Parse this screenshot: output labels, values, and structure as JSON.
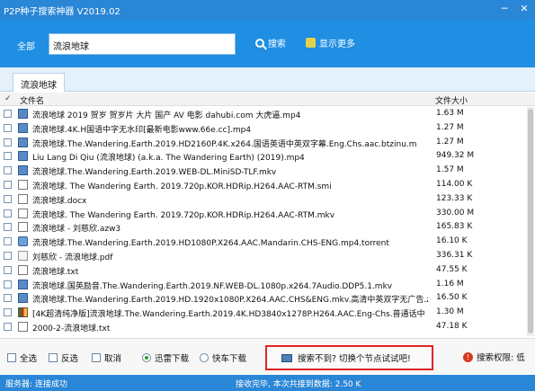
{
  "window": {
    "title": "P2P种子搜索神器  V2019.02",
    "minimize_glyph": "─",
    "close_glyph": "✕"
  },
  "search": {
    "scope": "全部",
    "query": "流浪地球",
    "search_label": "搜索",
    "more_label": "显示更多"
  },
  "tabs": [
    {
      "label": "流浪地球"
    }
  ],
  "list": {
    "header": {
      "check_glyph": "✓",
      "name": "文件名",
      "size": "文件大小"
    },
    "items": [
      {
        "icon": "video-file-icon",
        "name": "流浪地球 2019 贺岁 贺岁片 大片 国产 AV 电影 dahubi.com 大虎逼.mp4",
        "size": "1.63 M"
      },
      {
        "icon": "video-file-icon",
        "name": "流浪地球.4K.H国语中字无水印[最新电影www.66e.cc].mp4",
        "size": "1.27 M"
      },
      {
        "icon": "video-file-icon",
        "name": "流浪地球.The.Wandering.Earth.2019.HD2160P.4K.x264.国语英语中英双字幕.Eng.Chs.aac.btzinu.m",
        "size": "1.27 M"
      },
      {
        "icon": "video-file-icon",
        "name": "Liu Lang Di Qiu (流浪地球) (a.k.a. The Wandering Earth) (2019).mp4",
        "size": "949.32 M"
      },
      {
        "icon": "video-file-icon",
        "name": "流浪地球.The.Wandering.Earth.2019.WEB-DL.MiniSD-TLF.mkv",
        "size": "1.57 M"
      },
      {
        "icon": "document-file-icon",
        "name": "流浪地球. The Wandering Earth. 2019.720p.KOR.HDRip.H264.AAC-RTM.smi",
        "size": "114.00 K"
      },
      {
        "icon": "document-file-icon",
        "name": "流浪地球.docx",
        "size": "123.33 K"
      },
      {
        "icon": "document-file-icon",
        "name": "流浪地球. The Wandering Earth. 2019.720p.KOR.HDRip.H264.AAC-RTM.mkv",
        "size": "330.00 M"
      },
      {
        "icon": "document-file-icon",
        "name": "流浪地球 - 刘慈欣.azw3",
        "size": "165.83 K"
      },
      {
        "icon": "torrent-file-icon",
        "name": "流浪地球.The.Wandering.Earth.2019.HD1080P.X264.AAC.Mandarin.CHS-ENG.mp4.torrent",
        "size": "16.10 K"
      },
      {
        "icon": "pdf-file-icon",
        "name": "刘慈欣 - 流浪地球.pdf",
        "size": "336.31 K"
      },
      {
        "icon": "document-file-icon",
        "name": "流浪地球.txt",
        "size": "47.55 K"
      },
      {
        "icon": "video-file-icon",
        "name": "流浪地球.国英励音.The.Wandering.Earth.2019.NF.WEB-DL.1080p.x264.7Audio.DDP5.1.mkv",
        "size": "1.16 M"
      },
      {
        "icon": "video-file-icon",
        "name": "流浪地球.The.Wandering.Earth.2019.HD.1920x1080P.X264.AAC.CHS&ENG.mkv.高清中英双字无广告.z",
        "size": "16.50 K"
      },
      {
        "icon": "archive-file-icon",
        "name": "[4K超清纯净版]流浪地球.The.Wandering.Earth.2019.4K.HD3840x1278P.H264.AAC.Eng-Chs.普通话中",
        "size": "1.30 M"
      },
      {
        "icon": "document-file-icon",
        "name": "2000-2-流浪地球.txt",
        "size": "47.18 K"
      }
    ]
  },
  "bottom": {
    "select_all": "全选",
    "invert": "反选",
    "cancel": "取消",
    "xunlei": "迅雷下载",
    "kuaiche": "快车下载",
    "download_mode": "xunlei",
    "hint": "搜索不到? 切换个节点试试吧!",
    "permission": "搜索权限: 低"
  },
  "status": {
    "server": "服务器: 连接成功",
    "result": "接收完毕, 本次共接到数据: 2.50 K"
  },
  "colors": {
    "titlebar": "#2a86d6",
    "searchbar": "#1f8ee3",
    "hint_border": "#e02424",
    "radio_on": "#2a9d2a"
  }
}
